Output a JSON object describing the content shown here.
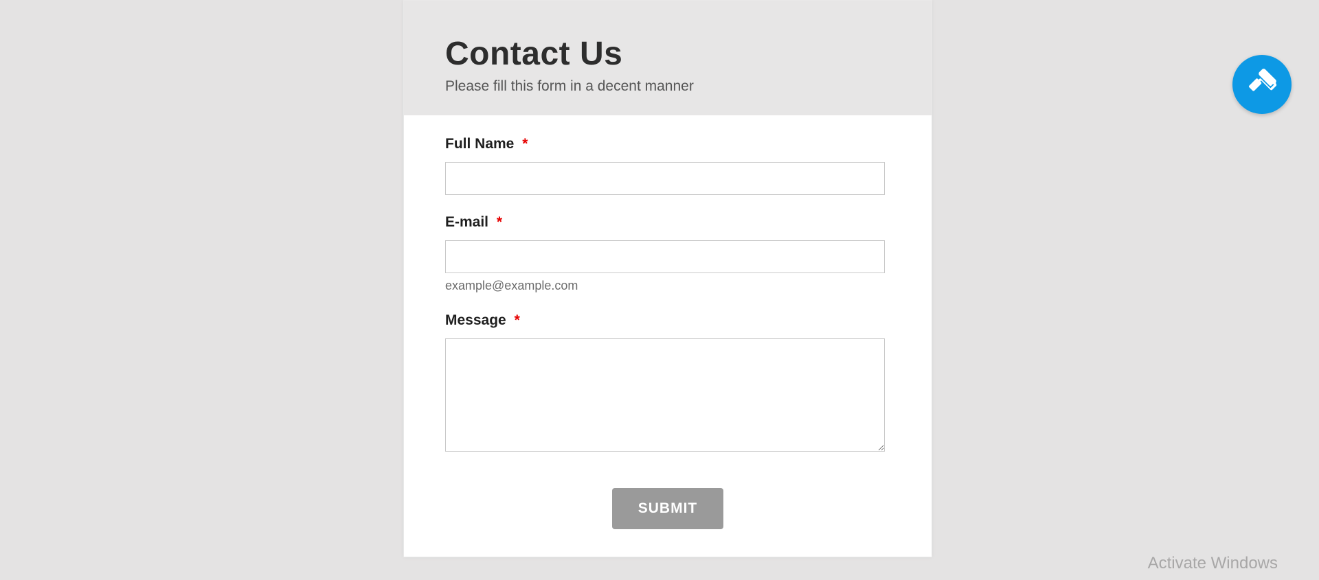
{
  "header": {
    "title": "Contact Us",
    "subtitle": "Please fill this form in a decent manner"
  },
  "fields": {
    "fullname": {
      "label": "Full Name",
      "required_marker": "*",
      "value": ""
    },
    "email": {
      "label": "E-mail",
      "required_marker": "*",
      "value": "",
      "hint": "example@example.com"
    },
    "message": {
      "label": "Message",
      "required_marker": "*",
      "value": ""
    }
  },
  "submit_label": "SUBMIT",
  "fab_icon": "paint-roller-icon",
  "watermark": "Activate Windows"
}
